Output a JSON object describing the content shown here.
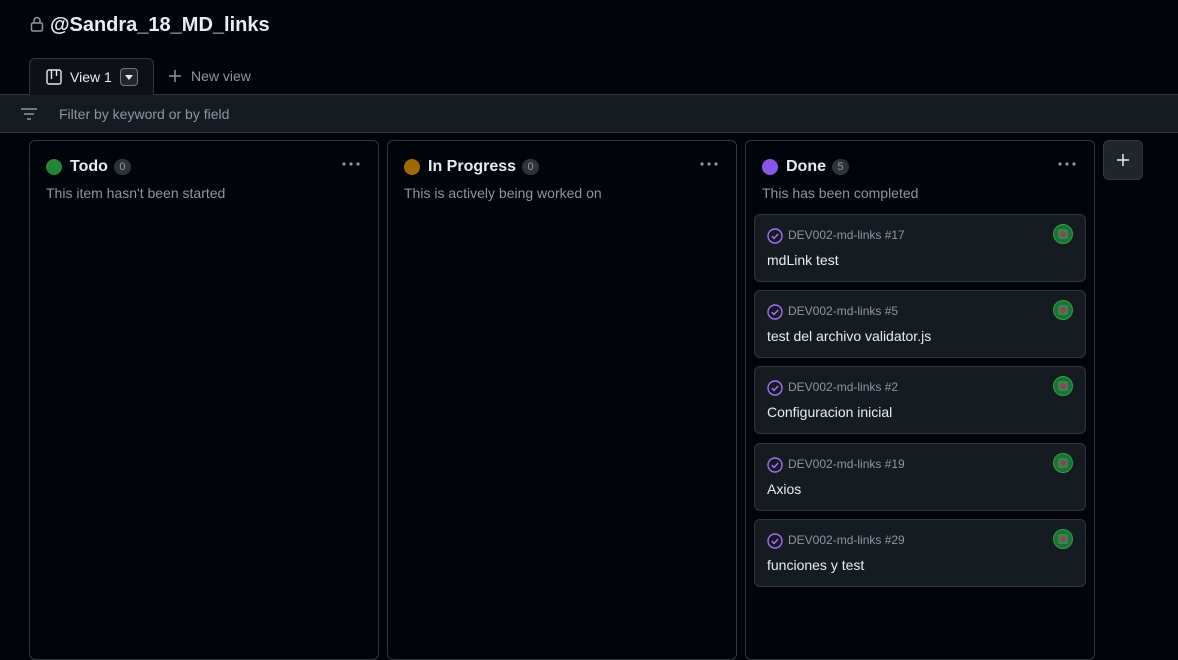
{
  "header": {
    "title": "@Sandra_18_MD_links",
    "icon": "lock-icon"
  },
  "tabs": {
    "active_label": "View 1",
    "new_view_label": "New view"
  },
  "filter": {
    "placeholder": "Filter by keyword or by field",
    "value": ""
  },
  "columns": [
    {
      "name": "Todo",
      "count": "0",
      "color": "#238636",
      "description": "This item hasn't been started",
      "cards": []
    },
    {
      "name": "In Progress",
      "count": "0",
      "color": "#9e6a03",
      "description": "This is actively being worked on",
      "cards": []
    },
    {
      "name": "Done",
      "count": "5",
      "color": "#8957e5",
      "description": "This has been completed",
      "cards": [
        {
          "ref": "DEV002-md-links #17",
          "title": "mdLink test"
        },
        {
          "ref": "DEV002-md-links #5",
          "title": "test del archivo validator.js"
        },
        {
          "ref": "DEV002-md-links #2",
          "title": "Configuracion inicial"
        },
        {
          "ref": "DEV002-md-links #19",
          "title": "Axios"
        },
        {
          "ref": "DEV002-md-links #29",
          "title": "funciones y test"
        }
      ]
    }
  ],
  "colors": {
    "closed_issue": "#a371f7",
    "border": "#30363d",
    "background": "#010409"
  }
}
